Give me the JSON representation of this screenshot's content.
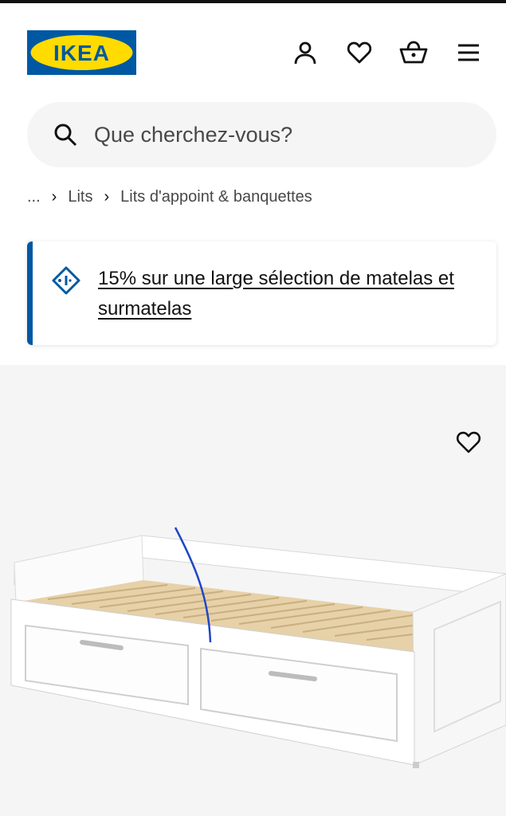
{
  "header": {
    "logo_text": "IKEA",
    "icons": [
      "account-icon",
      "heart-icon",
      "basket-icon",
      "menu-icon"
    ]
  },
  "search": {
    "placeholder": "Que cherchez-vous?",
    "icon": "search-icon"
  },
  "breadcrumb": {
    "ellipsis": "...",
    "separator": "›",
    "items": [
      "Lits",
      "Lits d'appoint & banquettes"
    ]
  },
  "promo": {
    "icon": "tag-icon",
    "text": "15% sur une large sélection de matelas et surmatelas",
    "accent_color": "#0058a3"
  },
  "product": {
    "favourite_icon": "heart-icon",
    "image_subject": "white daybed with two drawers"
  },
  "colors": {
    "brand_blue": "#0058a3",
    "brand_yellow": "#ffdb00",
    "background_grey": "#f5f5f5"
  }
}
